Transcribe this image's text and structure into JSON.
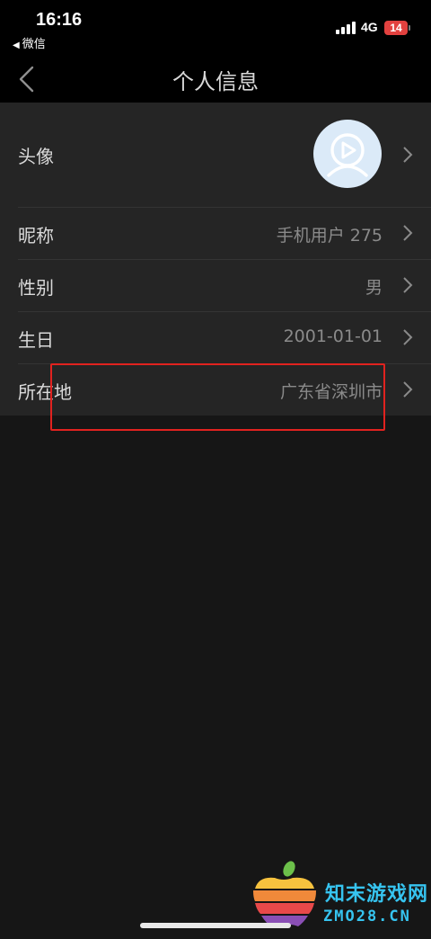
{
  "status_bar": {
    "time": "16:16",
    "back_app": "微信",
    "network": "4G",
    "battery": "14"
  },
  "nav": {
    "title": "个人信息",
    "back_icon": "chevron-left-icon"
  },
  "rows": [
    {
      "label": "头像",
      "value": "",
      "icon": "avatar-play-icon"
    },
    {
      "label": "昵称",
      "value": "手机用户 275"
    },
    {
      "label": "性别",
      "value": "男"
    },
    {
      "label": "生日",
      "value": "2001-01-01"
    },
    {
      "label": "所在地",
      "value": "广东省深圳市"
    }
  ],
  "colors": {
    "highlight_border": "#e1221f",
    "watermark": "#36c4f0",
    "battery_low": "#e2413f"
  },
  "watermark": {
    "name": "知末游戏网",
    "url": "ZMO28.CN"
  }
}
